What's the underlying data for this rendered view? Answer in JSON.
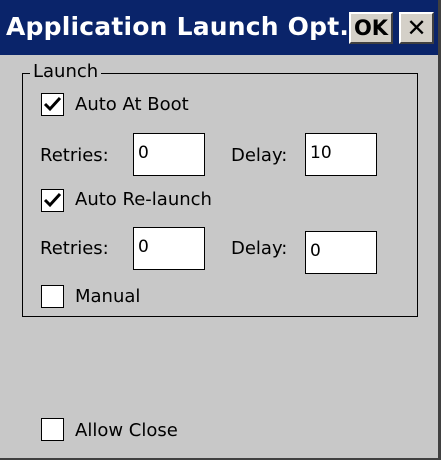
{
  "window": {
    "title": "Application Launch Opt...",
    "ok_label": "OK",
    "close_glyph": "✕"
  },
  "launch_group": {
    "legend": "Launch",
    "auto_at_boot": {
      "label": "Auto At Boot",
      "checked": true
    },
    "boot_retries": {
      "label": "Retries:",
      "value": "0"
    },
    "boot_delay": {
      "label": "Delay:",
      "value": "10"
    },
    "auto_relaunch": {
      "label": "Auto Re-launch",
      "checked": true
    },
    "relaunch_retries": {
      "label": "Retries:",
      "value": "0"
    },
    "relaunch_delay": {
      "label": "Delay:",
      "value": "0"
    },
    "manual": {
      "label": "Manual",
      "checked": false
    }
  },
  "allow_close": {
    "label": "Allow Close",
    "checked": false
  },
  "colors": {
    "titlebar": "#0a246a",
    "dialog_bg": "#c8c8c8"
  }
}
